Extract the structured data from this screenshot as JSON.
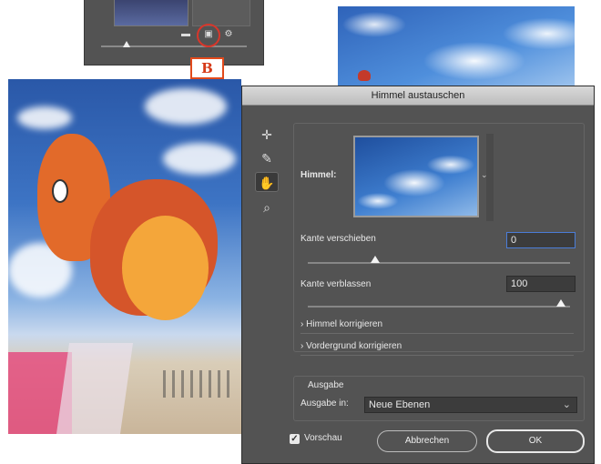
{
  "callout": {
    "label": "B"
  },
  "dialog": {
    "title": "Himmel austauschen",
    "sky_label": "Himmel:",
    "shift_edge_label": "Kante verschieben",
    "shift_edge_value": "0",
    "fade_edge_label": "Kante verblassen",
    "fade_edge_value": "100",
    "sky_adjust_label": "Himmel korrigieren",
    "foreground_adjust_label": "Vordergrund korrigieren",
    "output_section_label": "Ausgabe",
    "output_to_label": "Ausgabe in:",
    "output_to_value": "Neue Ebenen",
    "preview_label": "Vorschau",
    "cancel_label": "Abbrechen",
    "ok_label": "OK",
    "sliders": {
      "shift_edge_fraction": 0.5,
      "fade_edge_fraction": 1.0
    }
  },
  "icons": {
    "move_tool": "move-icon",
    "sky_brush_tool": "sky-brush-icon",
    "hand_tool": "hand-icon",
    "zoom_tool": "zoom-icon"
  },
  "colors": {
    "callout_red": "#d8362a",
    "dialog_bg": "#535353",
    "focus_blue": "#4b7dd8"
  }
}
